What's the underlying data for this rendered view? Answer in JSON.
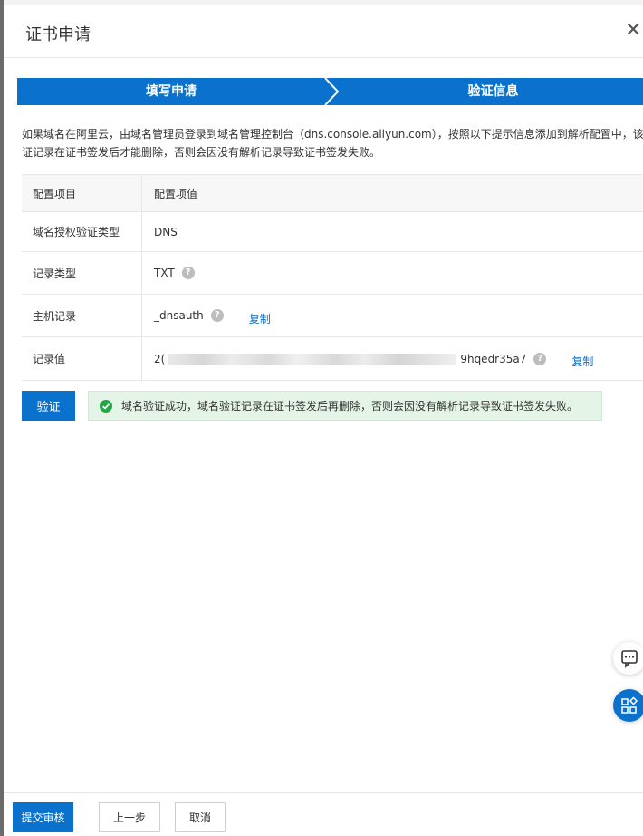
{
  "dialog": {
    "title": "证书申请",
    "close_glyph": "✕"
  },
  "steps": [
    {
      "label": "填写申请",
      "active": true
    },
    {
      "label": "验证信息",
      "active": true
    }
  ],
  "intro": {
    "line1": "如果域名在阿里云，由域名管理员登录到域名管理控制台（dns.console.aliyun.com），按照以下提示信息添加到解析配置中，该验",
    "line2": "证记录在证书签发后才能删除，否则会因没有解析记录导致证书签发失败。"
  },
  "table": {
    "headers": [
      "配置项目",
      "配置项值"
    ],
    "rows": [
      {
        "key": "域名授权验证类型",
        "value": "DNS"
      },
      {
        "key": "记录类型",
        "value": "TXT"
      },
      {
        "key": "主机记录",
        "value": "_dnsauth",
        "copy": "复制"
      },
      {
        "key": "记录值",
        "value_prefix": "2(",
        "value_suffix": "9hqedr35a7",
        "copy": "复制"
      }
    ],
    "help_glyph": "?"
  },
  "verify": {
    "button_label": "验证",
    "success_message": "域名验证成功，域名验证记录在证书签发后再删除，否则会因没有解析记录导致证书签发失败。"
  },
  "footer": {
    "submit_label": "提交审核",
    "prev_label": "上一步",
    "cancel_label": "取消"
  },
  "colors": {
    "primary": "#0a72cc",
    "success_bg": "#e4f5e7",
    "success_icon": "#1fa844"
  },
  "icons": {
    "close": "close-icon",
    "help": "help-icon",
    "success": "check-circle-icon",
    "chat": "chat-icon",
    "apps": "apps-icon"
  }
}
